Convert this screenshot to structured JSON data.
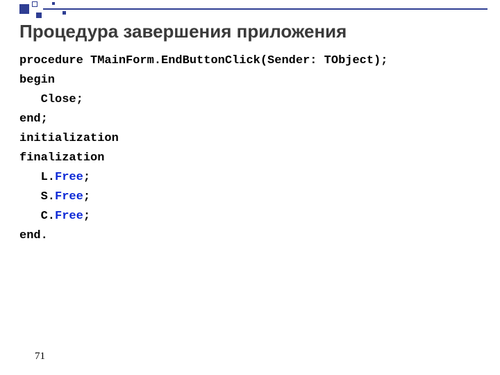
{
  "title": "Процедура завершения приложения",
  "code": {
    "l1": "procedure TMainForm.EndButtonClick(Sender: TObject);",
    "l2": "begin",
    "l3": "   Close;",
    "l4": "end;",
    "l5": "",
    "l6": "initialization",
    "l7": "",
    "l8": "finalization",
    "l9a": "   L.",
    "l9b": "Free",
    "l9c": ";",
    "l10a": "   S.",
    "l10b": "Free",
    "l10c": ";",
    "l11a": "   C.",
    "l11b": "Free",
    "l11c": ";",
    "l12": "",
    "l13": "end."
  },
  "pageNumber": "71"
}
